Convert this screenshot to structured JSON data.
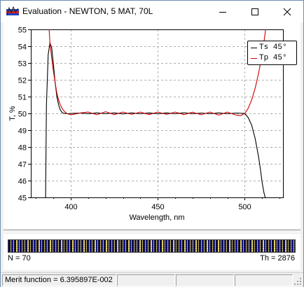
{
  "window": {
    "title": "Evaluation - NEWTON, 5 MAT, 70L",
    "minimize_icon": "minimize-icon",
    "maximize_icon": "maximize-icon",
    "close_icon": "close-icon"
  },
  "chart_data": {
    "type": "line",
    "xlabel": "Wavelength, nm",
    "ylabel": "T, %",
    "xlim": [
      377,
      522
    ],
    "ylim": [
      45,
      55
    ],
    "x_ticks": [
      400,
      450,
      500
    ],
    "y_ticks": [
      45,
      46,
      47,
      48,
      49,
      50,
      51,
      52,
      53,
      54,
      55
    ],
    "grid": true,
    "legend_position": "top-right",
    "series": [
      {
        "name": "Ts 45°",
        "color": "#000000",
        "x": [
          385.5,
          386,
          387,
          388,
          389,
          390,
          391,
          392,
          393,
          394,
          395,
          396,
          397,
          398,
          400,
          405,
          410,
          415,
          420,
          425,
          430,
          435,
          440,
          445,
          450,
          455,
          460,
          465,
          470,
          475,
          480,
          485,
          490,
          495,
          500,
          502,
          504,
          506,
          508,
          509,
          510,
          511,
          512
        ],
        "y": [
          45.0,
          50.5,
          53.5,
          54.2,
          53.9,
          52.9,
          51.8,
          51.0,
          50.5,
          50.2,
          50.05,
          50.0,
          50.0,
          49.98,
          50.0,
          50.02,
          49.98,
          50.03,
          49.98,
          50.03,
          49.97,
          50.03,
          49.98,
          50.03,
          49.98,
          50.03,
          49.98,
          50.04,
          49.98,
          50.02,
          49.98,
          50.03,
          49.98,
          50.02,
          50.0,
          49.75,
          49.3,
          48.5,
          47.4,
          46.7,
          45.9,
          45.3,
          44.9
        ]
      },
      {
        "name": "Tp 45°",
        "color": "#cc0000",
        "x": [
          387.5,
          388,
          389,
          390,
          391,
          392,
          393,
          394,
          395,
          396,
          397,
          398,
          400,
          402,
          405,
          410,
          415,
          420,
          425,
          430,
          435,
          440,
          445,
          450,
          455,
          460,
          465,
          470,
          475,
          480,
          485,
          490,
          495,
          498,
          500,
          502,
          504,
          506,
          508,
          510,
          511,
          512
        ],
        "y": [
          55.0,
          54.2,
          53.3,
          52.5,
          51.8,
          51.2,
          50.8,
          50.5,
          50.3,
          50.15,
          50.05,
          49.98,
          49.92,
          49.95,
          50.02,
          50.08,
          49.92,
          50.1,
          49.93,
          50.08,
          49.94,
          50.08,
          49.93,
          50.08,
          49.94,
          50.08,
          49.93,
          50.07,
          49.92,
          50.08,
          49.9,
          50.08,
          49.9,
          49.88,
          50.0,
          50.3,
          50.8,
          51.5,
          52.4,
          53.5,
          54.2,
          55.0
        ]
      }
    ]
  },
  "design": {
    "n_label": "N = 70",
    "th_label": "Th = 2876"
  },
  "status": {
    "merit": "Merit function = 6.395897E-002",
    "cell2": "",
    "cell3": "",
    "cell4": ""
  }
}
